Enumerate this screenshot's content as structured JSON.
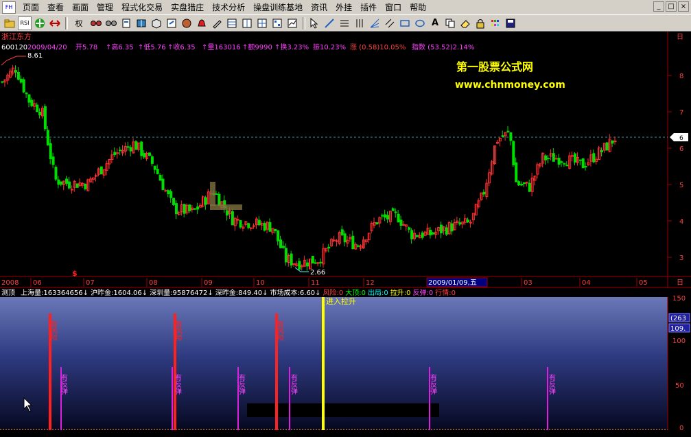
{
  "menubar": {
    "logo": "FH",
    "items": [
      "页面",
      "查看",
      "画面",
      "管理",
      "程式化交易",
      "实盘猎庄",
      "技术分析",
      "操盘训练基地",
      "资讯",
      "外挂",
      "插件",
      "窗口",
      "帮助"
    ]
  },
  "toolbar": {
    "rsi_label": "RSI",
    "quan_label": "权"
  },
  "stock": {
    "name": "浙江东方",
    "code": "600120",
    "date": "2009/04/20",
    "open_label": "开5.78",
    "high_label": "↑高6.35",
    "low_label": "↑低5.76",
    "close_label": "↑收6.35",
    "volume_label": "↑量163016",
    "amount_label": "↑额9990",
    "turnover_label": "↑换3.23%",
    "amplitude_label": "振10.23%",
    "change_label": "涨 (0.58)10.05%",
    "index_label": "指数 (53.52)2.14%"
  },
  "watermark": {
    "title": "第一股票公式网",
    "url": "www.chnmoney.com"
  },
  "price_axis": {
    "ticks": [
      "8",
      "7",
      "6",
      "5",
      "4",
      "3"
    ],
    "top_label": "日",
    "current_price": "6"
  },
  "price_annotations": {
    "high": "8.61",
    "low": "2.66",
    "buy_marker": "$"
  },
  "time_axis": {
    "labels": [
      "2008",
      "06",
      "07",
      "08",
      "09",
      "10",
      "11",
      "12",
      "2009/01/09,五",
      "03",
      "04",
      "05"
    ],
    "right_label": "日"
  },
  "indicator_header": {
    "name": "测顶",
    "items": [
      {
        "text": "上海量:163364656↓",
        "color": "#ffffff"
      },
      {
        "text": "沪昨金:1604.06↓",
        "color": "#ffffff"
      },
      {
        "text": "深圳量:95876472↓",
        "color": "#ffffff"
      },
      {
        "text": "深昨金:849.40↓",
        "color": "#ffffff"
      },
      {
        "text": "市场成本:6.60↓",
        "color": "#ffffff"
      },
      {
        "text": "风险:0",
        "color": "#ff4040"
      },
      {
        "text": "大顶:0",
        "color": "#00ff00"
      },
      {
        "text": "出局:0",
        "color": "#00ffff"
      },
      {
        "text": "拉升:0",
        "color": "#ffff00"
      },
      {
        "text": "反弹:0",
        "color": "#ff40ff"
      },
      {
        "text": "行情:0",
        "color": "#ff4040"
      }
    ]
  },
  "indicator_axis": {
    "ticks": [
      "150",
      "100",
      "50",
      "0"
    ],
    "box_value_1": "(263",
    "box_value_2": "109."
  },
  "signals": {
    "enter_rally": "进入拉升",
    "risk_label": "有风险",
    "rebound_label": "有反弹"
  },
  "colors": {
    "up_candle": "#ff3030",
    "down_candle": "#00dd00",
    "accent_yellow": "#ffff00",
    "signal_red": "#ff2020",
    "signal_magenta": "#e020e0"
  },
  "chart_data": {
    "type": "candlestick",
    "x_range": [
      "2008-05",
      "2009-04-20"
    ],
    "y_range": [
      2.66,
      8.61
    ],
    "current_close": 6.35,
    "reference_line": 6.35,
    "annotated_high": 8.61,
    "annotated_low": 2.66,
    "indicator_ylim": [
      0,
      150
    ],
    "risk_signals": 3,
    "rebound_signals": 6,
    "rally_signals": 1
  }
}
